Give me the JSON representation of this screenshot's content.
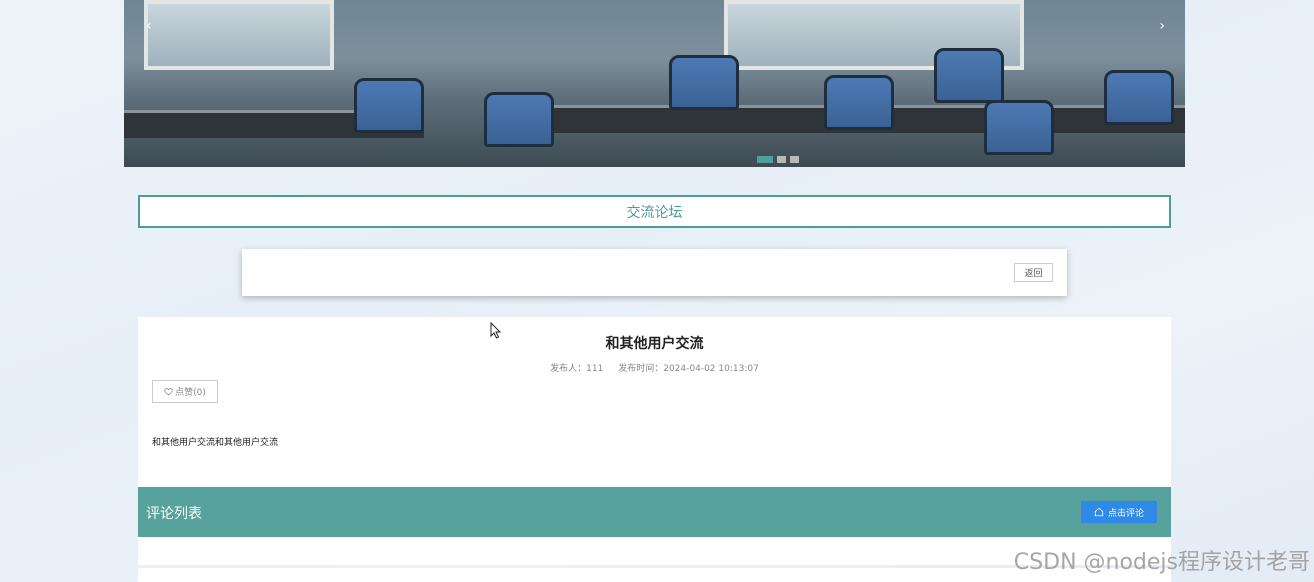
{
  "banner": {
    "prev_icon": "‹",
    "next_icon": "›",
    "slides": 3,
    "active_slide": 1
  },
  "section": {
    "title": "交流论坛"
  },
  "back_card": {
    "back_label": "返回"
  },
  "post": {
    "title": "和其他用户交流",
    "author_label": "发布人：111",
    "time_label": "发布时间：2024-04-02 10:13:07",
    "like_label": "点赞(0)",
    "like_icon": "heart-outline-icon",
    "content": "和其他用户交流和其他用户交流"
  },
  "comments": {
    "title": "评论列表",
    "comment_button_label": "点击评论",
    "comment_button_icon": "home-icon"
  },
  "watermark": "CSDN @nodejs程序设计老哥",
  "colors": {
    "accent": "#57a29c",
    "primary_button": "#2f89e8",
    "background": "#eef3f9"
  }
}
